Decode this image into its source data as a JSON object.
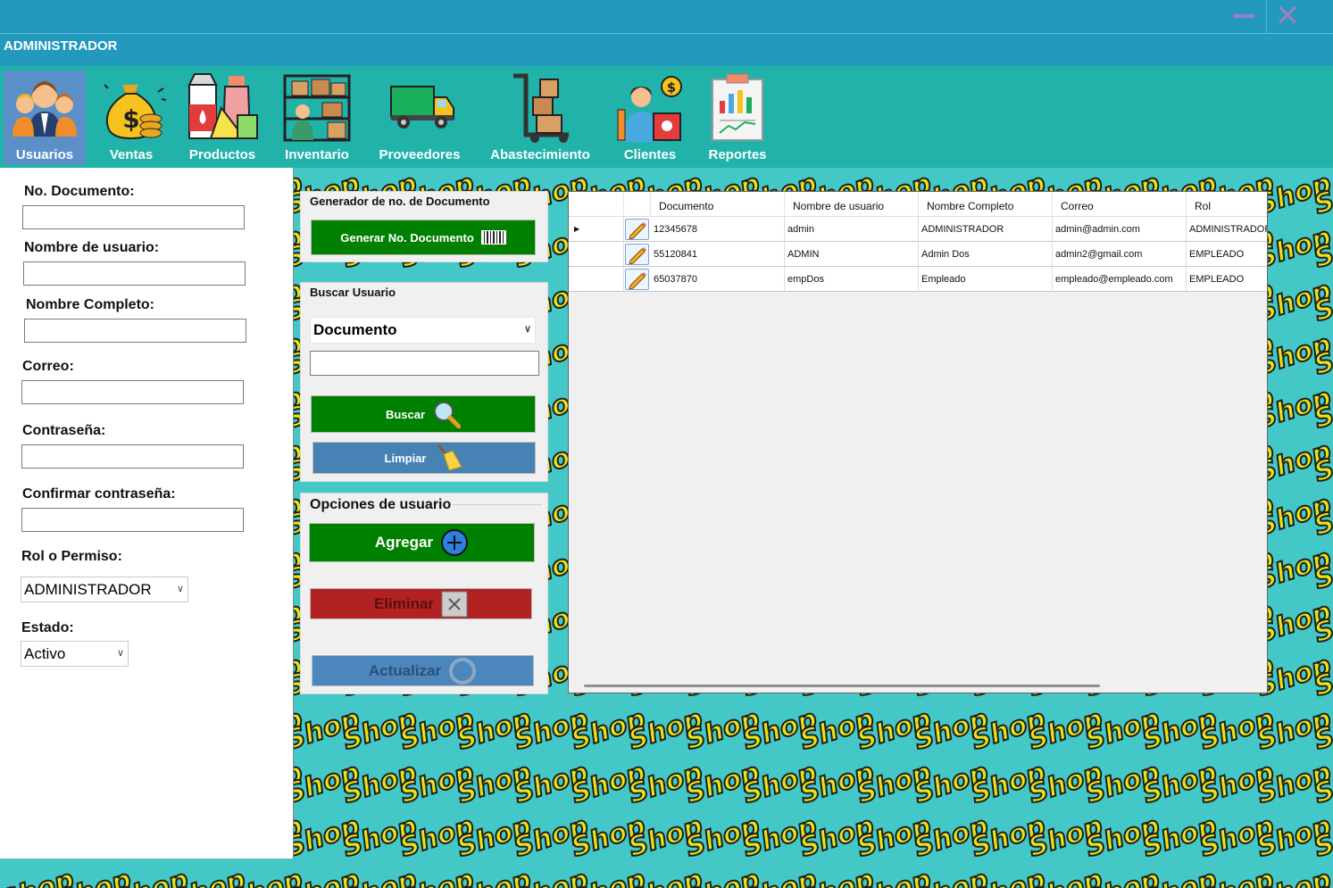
{
  "window": {
    "title": "ADMINISTRADOR"
  },
  "menu": [
    {
      "label": "Usuarios",
      "icon": "users-icon",
      "active": true
    },
    {
      "label": "Ventas",
      "icon": "money-bag-icon"
    },
    {
      "label": "Productos",
      "icon": "groceries-icon"
    },
    {
      "label": "Inventario",
      "icon": "warehouse-shelves-icon"
    },
    {
      "label": "Proveedores",
      "icon": "delivery-truck-icon"
    },
    {
      "label": "Abastecimiento",
      "icon": "hand-truck-icon"
    },
    {
      "label": "Clientes",
      "icon": "shopper-icon"
    },
    {
      "label": "Reportes",
      "icon": "report-clipboard-icon"
    }
  ],
  "form": {
    "documento_label": "No. Documento:",
    "usuario_label": "Nombre de usuario:",
    "nombre_label": "Nombre Completo:",
    "correo_label": "Correo:",
    "contrasena_label": "Contraseña:",
    "confirmar_label": "Confirmar contraseña:",
    "rol_label": "Rol o Permiso:",
    "rol_value": "ADMINISTRADOR",
    "estado_label": "Estado:",
    "estado_value": "Activo"
  },
  "generator": {
    "title": "Generador de no. de Documento",
    "button": "Generar No. Documento"
  },
  "search": {
    "title": "Buscar Usuario",
    "field_value": "Documento",
    "buscar": "Buscar",
    "limpiar": "Limpiar"
  },
  "options": {
    "title": "Opciones de usuario",
    "agregar": "Agregar",
    "eliminar": "Eliminar",
    "actualizar": "Actualizar"
  },
  "grid": {
    "headers": [
      "Documento",
      "Nombre de usuario",
      "Nombre Completo",
      "Correo",
      "Rol"
    ],
    "rows": [
      [
        "12345678",
        "admin",
        "ADMINISTRADOR",
        "admin@admin.com",
        "ADMINISTRADOR"
      ],
      [
        "55120841",
        "ADMIN",
        "Admin Dos",
        "admin2@gmail.com",
        "EMPLEADO"
      ],
      [
        "65037870",
        "empDos",
        "Empleado",
        "empleado@empleado.com",
        "EMPLEADO"
      ]
    ]
  },
  "background": {
    "pattern_text": "Shop"
  },
  "colors": {
    "titlebar": "#2299bd",
    "menubar": "#21b2aa",
    "active_menu": "#5a8fc8",
    "background": "#43c7c7",
    "green_button": "#008000",
    "blue_button": "#4682b4",
    "red_button": "#b22222"
  }
}
